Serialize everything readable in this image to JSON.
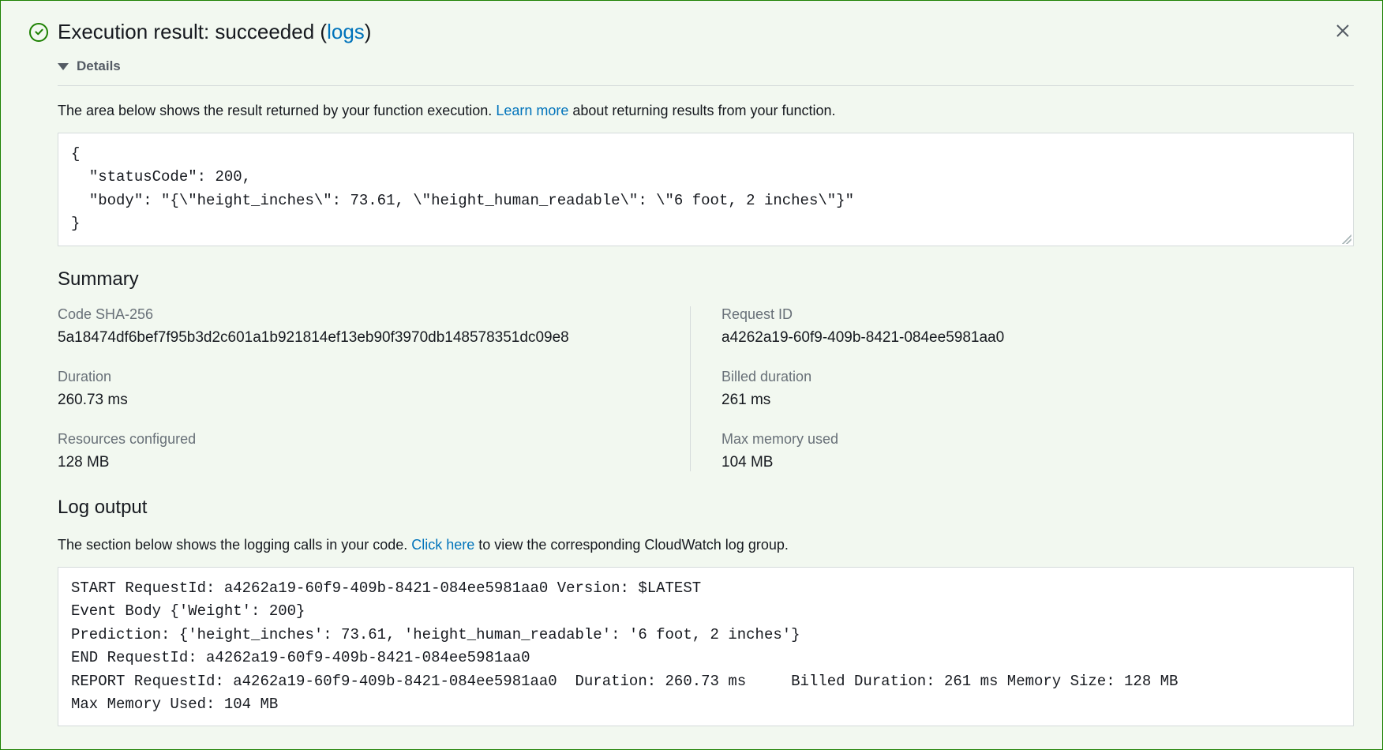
{
  "header": {
    "title_prefix": "Execution result: succeeded (",
    "logs_link": "logs",
    "title_suffix": ")"
  },
  "details": {
    "toggle_label": "Details",
    "desc_prefix": "The area below shows the result returned by your function execution. ",
    "learn_more": "Learn more",
    "desc_suffix": " about returning results from your function."
  },
  "result_json": "{\n  \"statusCode\": 200,\n  \"body\": \"{\\\"height_inches\\\": 73.61, \\\"height_human_readable\\\": \\\"6 foot, 2 inches\\\"}\"\n}",
  "summary": {
    "heading": "Summary",
    "code_sha_label": "Code SHA-256",
    "code_sha_value": "5a18474df6bef7f95b3d2c601a1b921814ef13eb90f3970db148578351dc09e8",
    "request_id_label": "Request ID",
    "request_id_value": "a4262a19-60f9-409b-8421-084ee5981aa0",
    "duration_label": "Duration",
    "duration_value": "260.73 ms",
    "billed_label": "Billed duration",
    "billed_value": "261 ms",
    "resources_label": "Resources configured",
    "resources_value": "128 MB",
    "max_mem_label": "Max memory used",
    "max_mem_value": "104 MB"
  },
  "log_output": {
    "heading": "Log output",
    "desc_prefix": "The section below shows the logging calls in your code. ",
    "click_here": "Click here",
    "desc_suffix": " to view the corresponding CloudWatch log group.",
    "content": "START RequestId: a4262a19-60f9-409b-8421-084ee5981aa0 Version: $LATEST\nEvent Body {'Weight': 200}\nPrediction: {'height_inches': 73.61, 'height_human_readable': '6 foot, 2 inches'}\nEND RequestId: a4262a19-60f9-409b-8421-084ee5981aa0\nREPORT RequestId: a4262a19-60f9-409b-8421-084ee5981aa0  Duration: 260.73 ms     Billed Duration: 261 ms Memory Size: 128 MB\nMax Memory Used: 104 MB"
  }
}
